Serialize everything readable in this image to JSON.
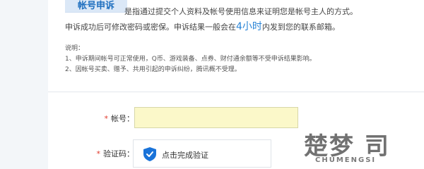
{
  "header": {
    "badge_label": "帐号申诉",
    "description": "是指通过提交个人资料及帐号使用信息来证明您是帐号主人的方式。",
    "line2_before": "申诉成功后可修改密码或密保。申诉结果一般会在",
    "line2_highlight": "4小时",
    "line2_after": "内发到您的联系邮箱。"
  },
  "notes": {
    "title": "说明：",
    "items": [
      "1、申诉期间帐号可正常使用，Q币、游戏装备、点券、财付通余额等不受申诉结果影响。",
      "2、因帐号买卖、赠予、共用引起的申诉纠纷，腾讯概不受理。"
    ]
  },
  "form": {
    "account_label": "帐号：",
    "account_value": "",
    "captcha_label": "验证码：",
    "captcha_button": "点击完成验证",
    "required_mark": "*"
  },
  "watermark": {
    "logo_text": "楚梦 司",
    "sub_text": "CHUMENGSI"
  },
  "colors": {
    "accent": "#2a84d6",
    "badge_bg": "#dbe8f7",
    "input_bg": "#fbf8c9",
    "required": "#e0392b"
  }
}
